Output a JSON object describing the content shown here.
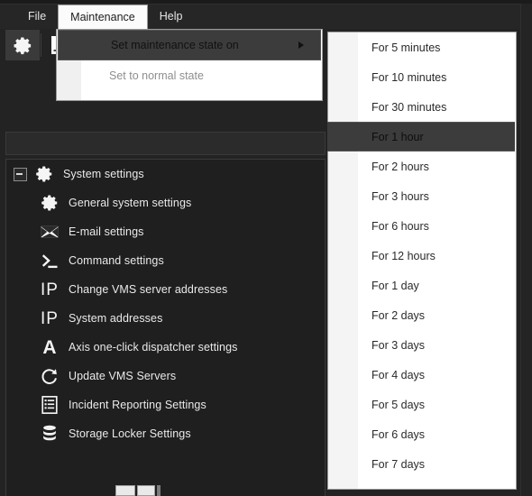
{
  "window": {
    "background_color": "#232323",
    "accent_highlight": "#3c3c3c"
  },
  "menubar": {
    "items": [
      {
        "label": "File",
        "open": false
      },
      {
        "label": "Maintenance",
        "open": true
      },
      {
        "label": "Help",
        "open": false
      }
    ]
  },
  "toolbar": {
    "buttons": [
      {
        "name": "settings-gear-button",
        "icon": "gear-icon",
        "selected": true
      },
      {
        "name": "new-document-button",
        "icon": "document-icon",
        "selected": false
      },
      {
        "name": "report-button",
        "icon": "lined-document-icon",
        "selected": false
      },
      {
        "name": "status-button",
        "icon": "green-blob-icon",
        "selected": false
      }
    ]
  },
  "filterbar": {
    "value": "",
    "placeholder": ""
  },
  "tree": {
    "root": {
      "label": "System settings",
      "icon": "gear-icon",
      "expanded": true,
      "expander": "minus-box-icon"
    },
    "children": [
      {
        "label": "General system settings",
        "icon": "gear-icon"
      },
      {
        "label": "E-mail settings",
        "icon": "envelope-icon"
      },
      {
        "label": "Command settings",
        "icon": "command-prompt-icon"
      },
      {
        "label": "Change VMS server addresses",
        "icon": "ip-icon"
      },
      {
        "label": "System addresses",
        "icon": "ip-icon"
      },
      {
        "label": "Axis one-click dispatcher settings",
        "icon": "letter-a-icon"
      },
      {
        "label": "Update VMS Servers",
        "icon": "refresh-c-icon"
      },
      {
        "label": "Incident Reporting Settings",
        "icon": "list-document-icon"
      },
      {
        "label": "Storage Locker Settings",
        "icon": "database-icon"
      }
    ]
  },
  "maintenance_menu": {
    "items": [
      {
        "label": "Set maintenance state on",
        "highlighted": true,
        "disabled": false,
        "has_submenu": true,
        "submenu_arrow": "caret-right-icon"
      },
      {
        "label": "Set to normal state",
        "highlighted": false,
        "disabled": true,
        "has_submenu": false
      }
    ]
  },
  "duration_submenu": {
    "items": [
      {
        "label": "For 5 minutes",
        "highlighted": false
      },
      {
        "label": "For 10 minutes",
        "highlighted": false
      },
      {
        "label": "For 30 minutes",
        "highlighted": false
      },
      {
        "label": "For 1 hour",
        "highlighted": true
      },
      {
        "label": "For 2 hours",
        "highlighted": false
      },
      {
        "label": "For 3 hours",
        "highlighted": false
      },
      {
        "label": "For 6 hours",
        "highlighted": false
      },
      {
        "label": "For 12 hours",
        "highlighted": false
      },
      {
        "label": "For 1 day",
        "highlighted": false
      },
      {
        "label": "For 2 days",
        "highlighted": false
      },
      {
        "label": "For 3 days",
        "highlighted": false
      },
      {
        "label": "For 4 days",
        "highlighted": false
      },
      {
        "label": "For 5 days",
        "highlighted": false
      },
      {
        "label": "For 6 days",
        "highlighted": false
      },
      {
        "label": "For 7 days",
        "highlighted": false
      }
    ]
  }
}
